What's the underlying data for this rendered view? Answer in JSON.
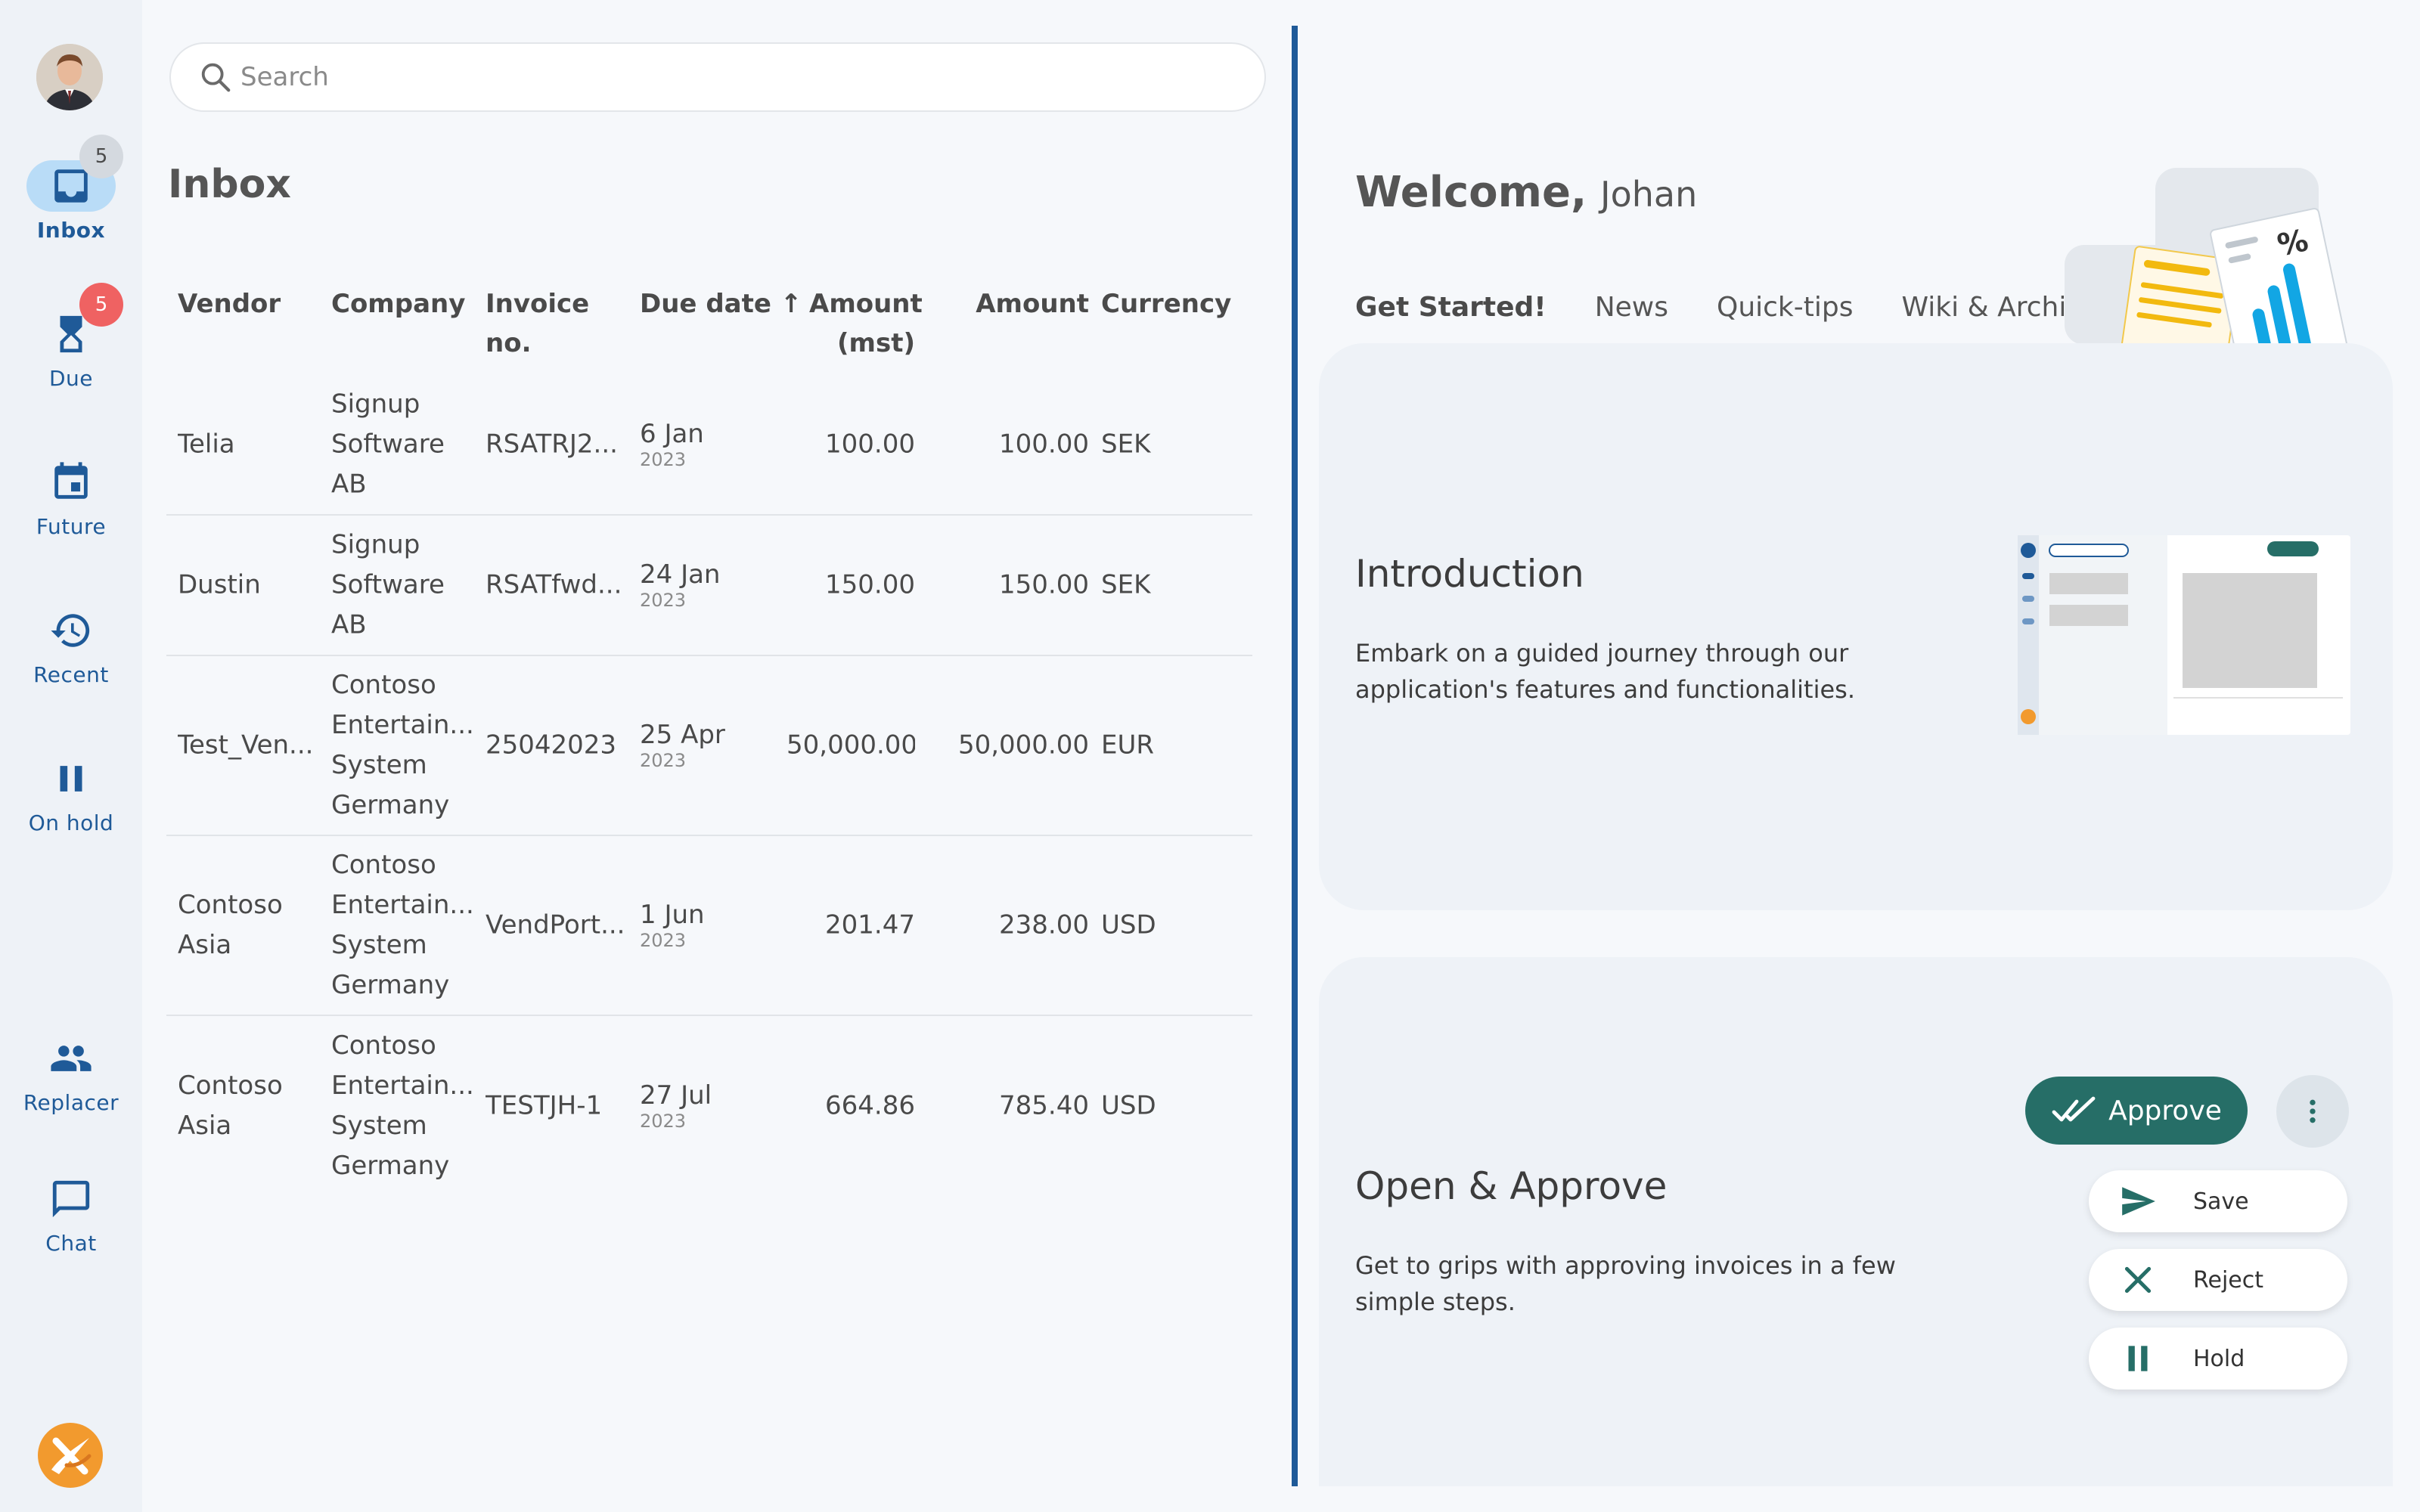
{
  "sidebar": {
    "items": [
      {
        "label": "Inbox",
        "badge": "5"
      },
      {
        "label": "Due",
        "badge": "5"
      },
      {
        "label": "Future"
      },
      {
        "label": "Recent"
      },
      {
        "label": "On hold"
      },
      {
        "label": "Replacer"
      },
      {
        "label": "Chat"
      }
    ]
  },
  "search": {
    "placeholder": "Search"
  },
  "inbox": {
    "title": "Inbox",
    "columns": {
      "vendor": "Vendor",
      "company": "Company",
      "invoice_no_1": "Invoice",
      "invoice_no_2": "no.",
      "due_date": "Due date ↑",
      "amount_mst_1": "Amount",
      "amount_mst_2": "(mst)",
      "amount": "Amount",
      "currency": "Currency"
    },
    "rows": [
      {
        "vendor_1": "Telia",
        "vendor_2": "",
        "company_1": "Signup",
        "company_2": "Software",
        "company_3": "AB",
        "company_4": "",
        "invoice": "RSATRJ2...",
        "due_day": "6 Jan",
        "due_year": "2023",
        "amount_mst": "100.00",
        "amount": "100.00",
        "currency": "SEK"
      },
      {
        "vendor_1": "Dustin",
        "vendor_2": "",
        "company_1": "Signup",
        "company_2": "Software",
        "company_3": "AB",
        "company_4": "",
        "invoice": "RSATfwd...",
        "due_day": "24 Jan",
        "due_year": "2023",
        "amount_mst": "150.00",
        "amount": "150.00",
        "currency": "SEK"
      },
      {
        "vendor_1": "Test_Ven...",
        "vendor_2": "",
        "company_1": "Contoso",
        "company_2": "Entertain...",
        "company_3": "System",
        "company_4": "Germany",
        "invoice": "25042023",
        "due_day": "25 Apr",
        "due_year": "2023",
        "amount_mst": "50,000.00",
        "amount": "50,000.00",
        "currency": "EUR"
      },
      {
        "vendor_1": "Contoso",
        "vendor_2": "Asia",
        "company_1": "Contoso",
        "company_2": "Entertain...",
        "company_3": "System",
        "company_4": "Germany",
        "invoice": "VendPort...",
        "due_day": "1 Jun",
        "due_year": "2023",
        "amount_mst": "201.47",
        "amount": "238.00",
        "currency": "USD"
      },
      {
        "vendor_1": "Contoso",
        "vendor_2": "Asia",
        "company_1": "Contoso",
        "company_2": "Entertain...",
        "company_3": "System",
        "company_4": "Germany",
        "invoice": "TESTJH-1",
        "due_day": "27 Jul",
        "due_year": "2023",
        "amount_mst": "664.86",
        "amount": "785.40",
        "currency": "USD"
      }
    ]
  },
  "welcome": {
    "greeting": "Welcome,",
    "name": "Johan",
    "tabs": [
      "Get Started!",
      "News",
      "Quick-tips",
      "Wiki & Archive"
    ]
  },
  "cards": {
    "intro": {
      "title": "Introduction",
      "text": "Embark on a guided journey through our application's features and functionalities."
    },
    "approve": {
      "title": "Open & Approve",
      "text": "Get to grips with approving invoices in a few simple steps.",
      "approve_label": "Approve",
      "save_label": "Save",
      "reject_label": "Reject",
      "hold_label": "Hold"
    }
  },
  "colors": {
    "nav": "#1f5a98",
    "accent_teal": "#266e67",
    "badge_red": "#ef6262",
    "active_nav_bg": "#b9dcf7"
  }
}
